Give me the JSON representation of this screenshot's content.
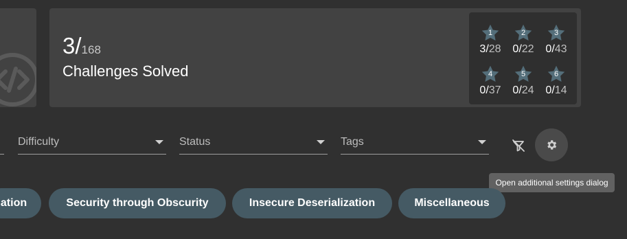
{
  "score": {
    "solved": "3/",
    "total": "168",
    "label": "Challenges Solved"
  },
  "difficulty_stars": [
    {
      "level": "1",
      "solved": "3/",
      "total": "28"
    },
    {
      "level": "2",
      "solved": "0/",
      "total": "22"
    },
    {
      "level": "3",
      "solved": "0/",
      "total": "43"
    },
    {
      "level": "4",
      "solved": "0/",
      "total": "37"
    },
    {
      "level": "5",
      "solved": "0/",
      "total": "24"
    },
    {
      "level": "6",
      "solved": "0/",
      "total": "14"
    }
  ],
  "filters": {
    "difficulty_label": "Difficulty",
    "status_label": "Status",
    "tags_label": "Tags"
  },
  "settings_tooltip": "Open additional settings dialog",
  "category_chips": [
    "ation",
    "Security through Obscurity",
    "Insecure Deserialization",
    "Miscellaneous"
  ],
  "icons": {
    "code": "code-icon",
    "star": "star-icon",
    "clear_filter": "filter-off-icon",
    "settings": "gear-icon"
  },
  "colors": {
    "background": "#303030",
    "card": "#424242",
    "chip": "#455a64",
    "star": "#546e7a",
    "tooltip": "#616161"
  }
}
